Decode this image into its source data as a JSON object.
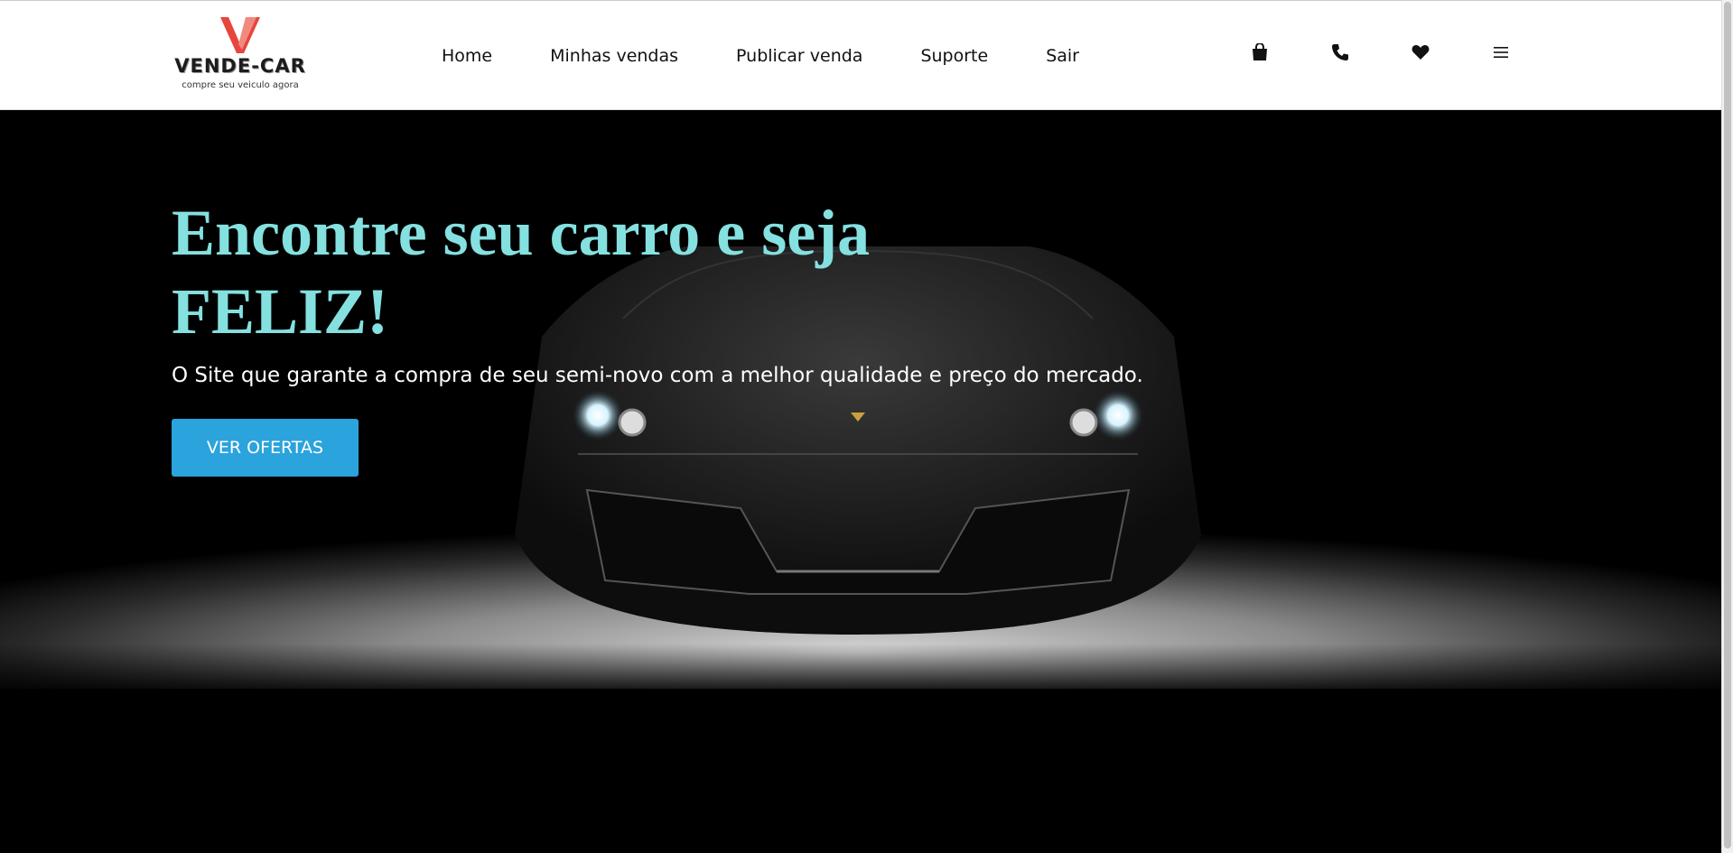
{
  "brand": {
    "name": "VENDE-CAR",
    "tagline": "compre seu veiculo agora",
    "logo_colors": [
      "#e8453c",
      "#f08a80"
    ]
  },
  "nav": {
    "items": [
      {
        "label": "Home"
      },
      {
        "label": "Minhas vendas"
      },
      {
        "label": "Publicar venda"
      },
      {
        "label": "Suporte"
      },
      {
        "label": "Sair"
      }
    ]
  },
  "header_icons": [
    "shopping-bag-icon",
    "phone-icon",
    "heart-icon",
    "menu-icon"
  ],
  "hero": {
    "title_line1": "Encontre seu carro e seja",
    "title_line2": "FELIZ!",
    "subtitle": "O Site que garante a compra de seu semi-novo com a melhor qualidade e preço do mercado.",
    "cta_label": "VER OFERTAS",
    "title_color": "#85e0e0",
    "cta_color": "#2ba3dc"
  }
}
